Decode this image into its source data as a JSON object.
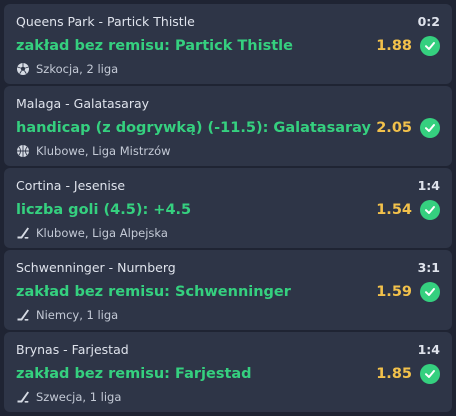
{
  "colors": {
    "background": "#1f2433",
    "card": "#2e3547",
    "bet_text": "#35d07f",
    "odds": "#f2c14b",
    "check_badge": "#35d07f"
  },
  "bets": [
    {
      "match": "Queens Park - Partick Thistle",
      "score": "0:2",
      "bet": "zakład bez remisu: Partick Thistle",
      "odds": "1.88",
      "status_icon": "check-circle-icon",
      "sport_icon": "soccer-ball-icon",
      "league": "Szkocja, 2 liga"
    },
    {
      "match": "Malaga - Galatasaray",
      "score": "",
      "bet": "handicap (z dogrywką) (-11.5): Galatasaray",
      "odds": "2.05",
      "status_icon": "check-circle-icon",
      "sport_icon": "basketball-icon",
      "league": "Klubowe, Liga Mistrzów"
    },
    {
      "match": "Cortina - Jesenise",
      "score": "1:4",
      "bet": "liczba goli (4.5): +4.5",
      "odds": "1.54",
      "status_icon": "check-circle-icon",
      "sport_icon": "hockey-stick-icon",
      "league": "Klubowe, Liga Alpejska"
    },
    {
      "match": "Schwenninger - Nurnberg",
      "score": "3:1",
      "bet": "zakład bez remisu: Schwenninger",
      "odds": "1.59",
      "status_icon": "check-circle-icon",
      "sport_icon": "hockey-stick-icon",
      "league": "Niemcy, 1 liga"
    },
    {
      "match": "Brynas - Farjestad",
      "score": "1:4",
      "bet": "zakład bez remisu: Farjestad",
      "odds": "1.85",
      "status_icon": "check-circle-icon",
      "sport_icon": "hockey-stick-icon",
      "league": "Szwecja, 1 liga"
    }
  ]
}
